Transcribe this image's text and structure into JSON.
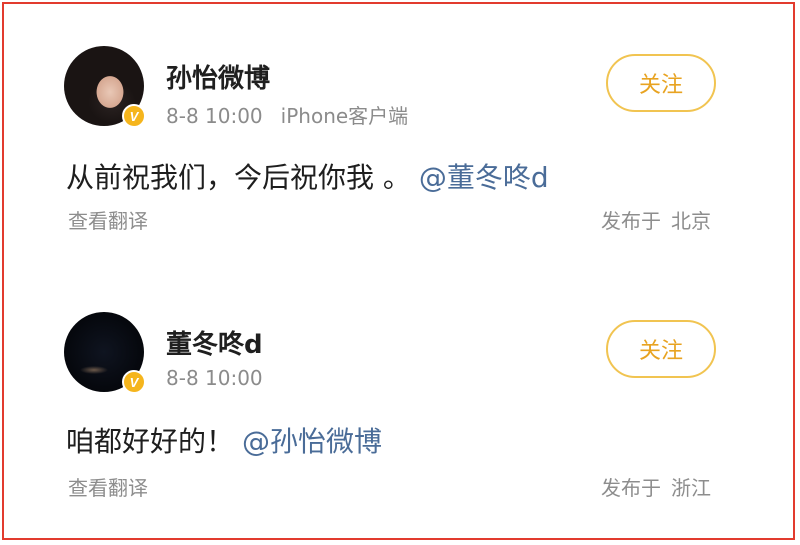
{
  "posts": [
    {
      "author": "孙怡微博",
      "date": "8-8 10:00",
      "device": "iPhone客户端",
      "follow_label": "关注",
      "badge": "V",
      "text": "从前祝我们，今后祝你我 。",
      "mention": "@董冬咚d",
      "translate_label": "查看翻译",
      "published_label": "发布于",
      "location": "北京"
    },
    {
      "author": "董冬咚d",
      "date": "8-8 10:00",
      "device": "",
      "follow_label": "关注",
      "badge": "V",
      "text": "咱都好好的！",
      "mention": "@孙怡微博",
      "translate_label": "查看翻译",
      "published_label": "发布于",
      "location": "浙江"
    }
  ],
  "colors": {
    "frame_border": "#e23b2e",
    "follow_border": "#f1c451",
    "follow_text": "#e8a321",
    "verified_badge": "#f5b51d",
    "mention": "#4a6c98",
    "secondary_text": "#8b8b8b"
  }
}
